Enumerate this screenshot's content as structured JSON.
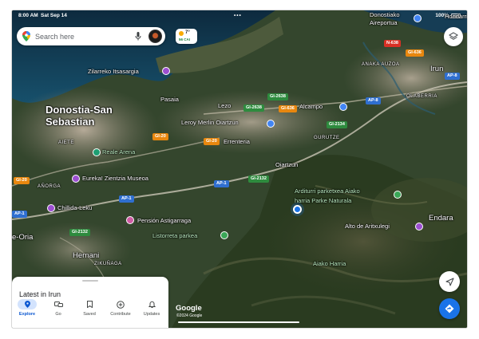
{
  "status_bar": {
    "time": "8:00 AM",
    "date": "Sat Sep 14",
    "dots": "•••",
    "battery_text": "100%"
  },
  "search": {
    "placeholder": "Search here",
    "icons": [
      "maps-pin-icon",
      "mic-icon",
      "profile-avatar"
    ]
  },
  "weather": {
    "temp": "7°",
    "aqi": "56 CAI"
  },
  "map": {
    "cities": [
      {
        "id": "donostia",
        "text": "Donostia-San\nSebastian"
      },
      {
        "id": "irun",
        "text": "Irun"
      },
      {
        "id": "hondarribia",
        "text": "Hondarribia"
      }
    ],
    "places": {
      "zilarreko": "Zilarreko Itsasargia",
      "pasaia": "Pasaia",
      "lezo": "Lezo",
      "alcampo": "Alcampo",
      "leroy": "Leroy Merlin Oiartzun",
      "errenteria": "Errenteria",
      "oiartzun": "Oiartzun",
      "reale_arena": "Reale Arena",
      "eureka": "Eureka! Zientzia Museoa",
      "ardituri": "Arditurri parketxea Aiako\nharria Parke Naturala",
      "endara": "Endara",
      "aritxulegi": "Alto de Aritxulegi",
      "chillida": "Chillida-Leku",
      "pension": "Pensión Astigarraga",
      "listorreta": "Listorreta parkea",
      "oria": "e-Oria",
      "hernani": "Hernani",
      "aiako_harria": "Aiako Harria",
      "donostia_airport": "Donostiako\nAireportua",
      "aiete": "AIETE",
      "anorga": "AÑORGA",
      "gurutze": "GURUTZE",
      "anaka": "ANAKA AUZOA",
      "olaberria": "OLABERRIA",
      "zikuñaga": "ZIKUÑAGA"
    },
    "roads": {
      "gi2638a": "GI-2638",
      "gi2638b": "GI-2638",
      "gi636a": "GI-636",
      "gi636b": "GI-636",
      "gi20a": "GI-20",
      "gi20b": "GI-20",
      "gi20c": "GI-20",
      "gi2134": "GI-2134",
      "gi2132a": "GI-2132",
      "gi2132b": "GI-2132",
      "ap1a": "AP-1",
      "ap1b": "AP-1",
      "ap1c": "AP-1",
      "ap8a": "AP-8",
      "ap8b": "AP-8",
      "n638": "N-638"
    },
    "attribution": "Google",
    "copyright": "©2024 Google"
  },
  "sheet": {
    "title": "Latest in Irun"
  },
  "nav": [
    {
      "label": "Explore",
      "icon": "location-pin-icon",
      "active": true
    },
    {
      "label": "Go",
      "icon": "commute-icon",
      "active": false
    },
    {
      "label": "Saved",
      "icon": "bookmark-icon",
      "active": false
    },
    {
      "label": "Contribute",
      "icon": "add-circle-icon",
      "active": false
    },
    {
      "label": "Updates",
      "icon": "bell-icon",
      "active": false
    }
  ],
  "colors": {
    "accent": "#1a73e8",
    "nav_active_bg": "#d3e3fd"
  }
}
